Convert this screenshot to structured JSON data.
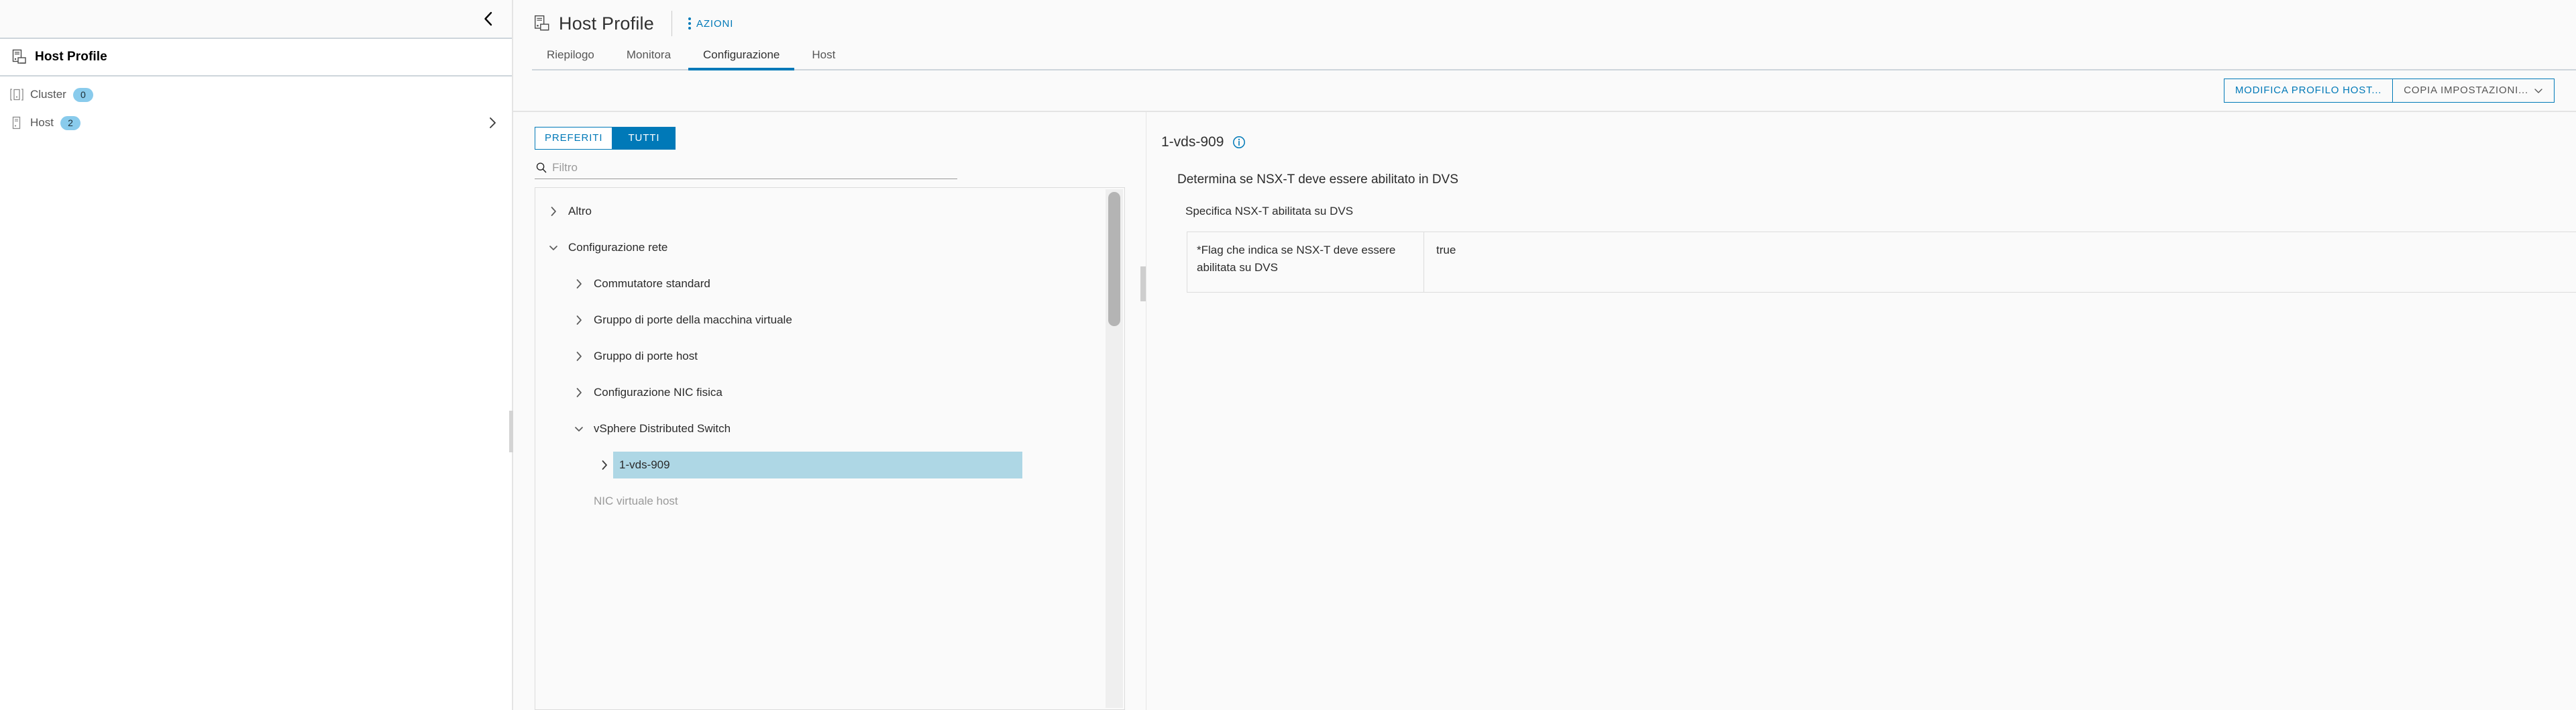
{
  "colors": {
    "accent": "#0079b8",
    "selection": "#aed7e5",
    "badge": "#89cbec",
    "border": "#cdd5db",
    "muted_text": "#9a9a9a",
    "page_bg": "#fafafa"
  },
  "sidebar": {
    "collapse_icon": "chevron-left-icon",
    "object": {
      "icon": "host-profile-icon",
      "title": "Host Profile"
    },
    "items": [
      {
        "icon": "cluster-icon",
        "label": "Cluster",
        "count": "0",
        "expandable": false
      },
      {
        "icon": "host-icon",
        "label": "Host",
        "count": "2",
        "expandable": true
      }
    ]
  },
  "header": {
    "icon": "host-profile-icon",
    "title": "Host Profile",
    "actions_label": "AZIONI",
    "actions_icon": "kebab-menu-icon"
  },
  "tabs": [
    {
      "label": "Riepilogo",
      "active": false
    },
    {
      "label": "Monitora",
      "active": false
    },
    {
      "label": "Configurazione",
      "active": true
    },
    {
      "label": "Host",
      "active": false
    }
  ],
  "toolbar": {
    "edit_profile_label": "MODIFICA PROFILO HOST...",
    "copy_settings_label": "COPIA IMPOSTAZIONI...",
    "copy_settings_caret": "chevron-down-icon"
  },
  "tree_panel": {
    "toggles": [
      {
        "label": "PREFERITI",
        "active": false
      },
      {
        "label": "TUTTI",
        "active": true
      }
    ],
    "filter": {
      "icon": "search-icon",
      "placeholder": "Filtro",
      "value": ""
    },
    "items": [
      {
        "label": "Altro",
        "indent": 0,
        "state": "collapsed",
        "selected": false,
        "muted": false
      },
      {
        "label": "Configurazione rete",
        "indent": 0,
        "state": "expanded",
        "selected": false,
        "muted": false
      },
      {
        "label": "Commutatore standard",
        "indent": 1,
        "state": "collapsed",
        "selected": false,
        "muted": false
      },
      {
        "label": "Gruppo di porte della macchina virtuale",
        "indent": 1,
        "state": "collapsed",
        "selected": false,
        "muted": false
      },
      {
        "label": "Gruppo di porte host",
        "indent": 1,
        "state": "collapsed",
        "selected": false,
        "muted": false
      },
      {
        "label": "Configurazione NIC fisica",
        "indent": 1,
        "state": "collapsed",
        "selected": false,
        "muted": false
      },
      {
        "label": "vSphere Distributed Switch",
        "indent": 1,
        "state": "expanded",
        "selected": false,
        "muted": false
      },
      {
        "label": "1-vds-909",
        "indent": 2,
        "state": "collapsed",
        "selected": true,
        "muted": false
      },
      {
        "label": "NIC virtuale host",
        "indent": 1,
        "state": "none",
        "selected": false,
        "muted": true
      }
    ]
  },
  "detail": {
    "title": "1-vds-909",
    "info_icon": "info-circle-icon",
    "description": "Determina se NSX-T deve essere abilitato in DVS",
    "subtitle": "Specifica NSX-T abilitata su DVS",
    "rows": [
      {
        "key": "*Flag che indica se NSX-T deve essere abilitata su DVS",
        "value": "true"
      }
    ]
  }
}
